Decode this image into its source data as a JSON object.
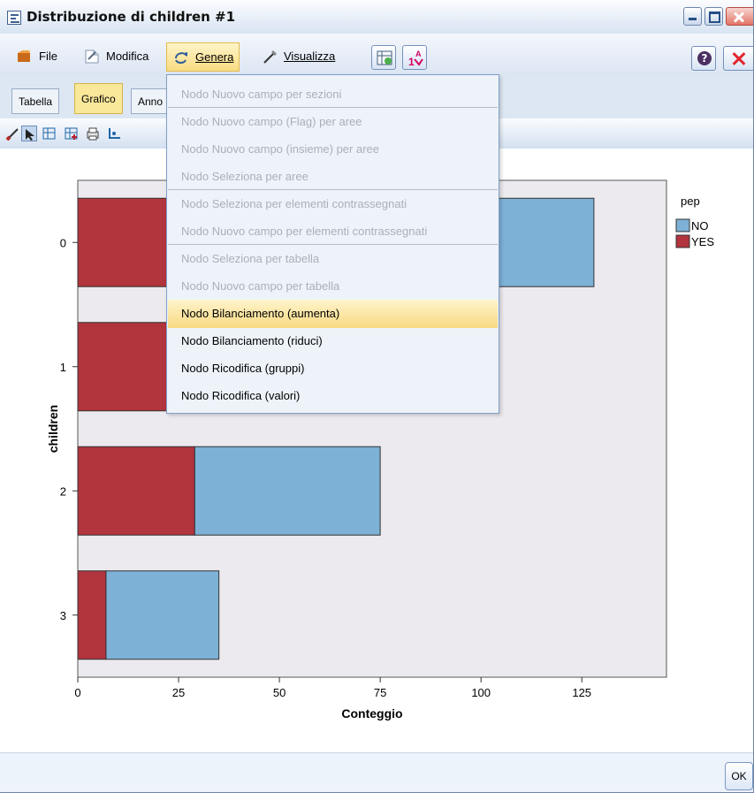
{
  "window": {
    "title": "Distribuzione di children #1",
    "buttons": [
      "minimize",
      "maximize",
      "close"
    ]
  },
  "menubar": {
    "items": [
      {
        "label": "File",
        "underline_index": 0,
        "icon": "file-icon"
      },
      {
        "label": "Modifica",
        "underline_index": -1,
        "icon": "edit-icon"
      },
      {
        "label": "Genera",
        "underline_index": 0,
        "icon": "generate-icon",
        "active": true
      },
      {
        "label": "Visualizza",
        "underline_index": 0,
        "icon": "view-icon"
      }
    ],
    "toolbar_icons": [
      "table-export-icon",
      "sort-icon",
      "help-icon",
      "close-icon"
    ]
  },
  "tabs": {
    "items": [
      "Tabella",
      "Grafico",
      "Annotazioni"
    ],
    "active": "Grafico",
    "visible_labels": [
      "Tabella",
      "Grafico",
      "Anno"
    ]
  },
  "subtoolbar": {
    "icons": [
      "brush-icon",
      "pointer-icon",
      "grid-icon",
      "grid-plus-icon",
      "printer-icon",
      "axis-icon"
    ]
  },
  "dropdown": {
    "items": [
      {
        "label": "Nodo Nuovo campo per sezioni",
        "enabled": false
      },
      {
        "label": "Nodo Nuovo campo (Flag) per aree",
        "enabled": false
      },
      {
        "label": "Nodo Nuovo campo (insieme) per aree",
        "enabled": false
      },
      {
        "label": "Nodo Seleziona per aree",
        "enabled": false
      },
      {
        "label": "Nodo Seleziona per elementi contrassegnati",
        "enabled": false
      },
      {
        "label": "Nodo Nuovo campo per elementi contrassegnati",
        "enabled": false
      },
      {
        "label": "Nodo Seleziona per tabella",
        "enabled": false
      },
      {
        "label": "Nodo Nuovo campo per tabella",
        "enabled": false
      },
      {
        "label": "Nodo Bilanciamento (aumenta)",
        "enabled": true,
        "highlighted": true
      },
      {
        "label": "Nodo Bilanciamento (riduci)",
        "enabled": true
      },
      {
        "label": "Nodo Ricodifica (gruppi)",
        "enabled": true
      },
      {
        "label": "Nodo Ricodifica (valori)",
        "enabled": true
      }
    ]
  },
  "chart_data": {
    "type": "bar",
    "orientation": "horizontal",
    "stacked": true,
    "categories": [
      "0",
      "1",
      "2",
      "3"
    ],
    "series": [
      {
        "name": "YES",
        "values": [
          45,
          42,
          29,
          7
        ],
        "color": "#b2343d"
      },
      {
        "name": "NO",
        "values": [
          83,
          0,
          46,
          28
        ],
        "color": "#7db1d6"
      }
    ],
    "xlabel": "Conteggio",
    "ylabel": "children",
    "xlim": [
      0,
      146
    ],
    "xticks": [
      0,
      25,
      50,
      75,
      100,
      125
    ],
    "legend": {
      "title": "pep",
      "items": [
        "NO",
        "YES"
      ],
      "placement": "top-right"
    },
    "plot_background": "#eceaee"
  },
  "bottom": {
    "ok_label": "OK"
  }
}
